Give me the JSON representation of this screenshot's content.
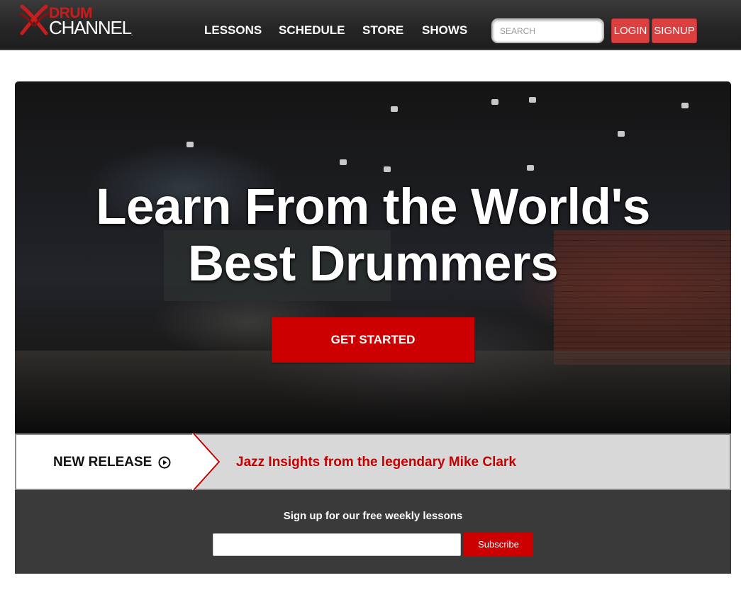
{
  "brand": {
    "logo_top": "DRUM",
    "logo_bottom": "CHANNEL",
    "logo_mark": "drumsticks-x-icon",
    "colors": {
      "red": "#cc0000",
      "header": "#2a2a2a",
      "button": "#d9403f"
    }
  },
  "nav": {
    "items": [
      {
        "label": "LESSONS"
      },
      {
        "label": "SCHEDULE"
      },
      {
        "label": "STORE"
      },
      {
        "label": "SHOWS"
      }
    ],
    "search_placeholder": "SEARCH",
    "login_label": "LOGIN",
    "signup_label": "SIGNUP"
  },
  "hero": {
    "headline_line1": "Learn From the World's",
    "headline_line2": "Best Drummers",
    "cta_label": "GET STARTED"
  },
  "release": {
    "tag_label": "NEW RELEASE",
    "tag_icon": "play-circle-icon",
    "title": "Jazz Insights from the legendary Mike Clark"
  },
  "newsletter": {
    "label": "Sign up for our free weekly lessons",
    "email_value": "",
    "subscribe_label": "Subscribe"
  }
}
